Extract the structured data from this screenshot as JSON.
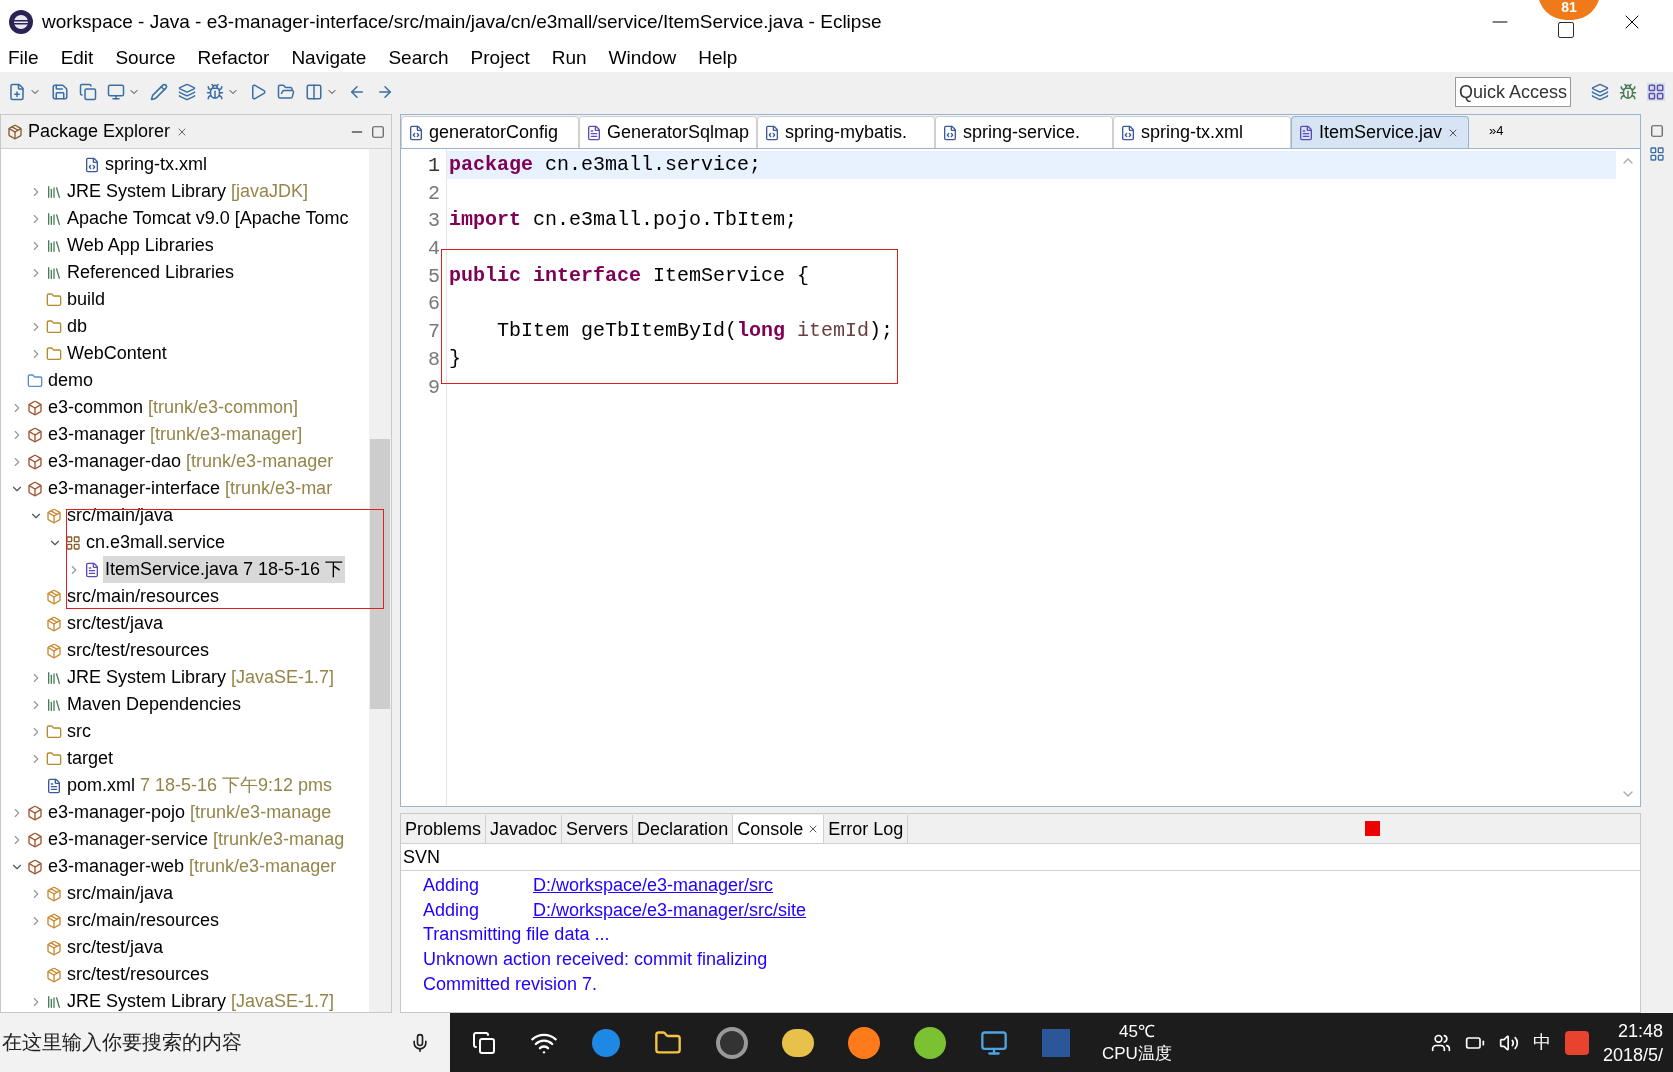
{
  "window": {
    "title": "workspace - Java - e3-manager-interface/src/main/java/cn/e3mall/service/ItemService.java - Eclipse",
    "badge": "81"
  },
  "menu": [
    "File",
    "Edit",
    "Source",
    "Refactor",
    "Navigate",
    "Search",
    "Project",
    "Run",
    "Window",
    "Help"
  ],
  "quick_access": {
    "placeholder": "Quick Access"
  },
  "package_explorer": {
    "title": "Package Explorer",
    "tree": [
      {
        "children": [
          {
            "children": [
              {
                "children": [
                  {
                    "label": "spring-tx.xml",
                    "kind": "xml",
                    "selected": false
                  }
                ]
              }
            ]
          },
          {
            "label": "JRE System Library",
            "decoration": "[javaJDK]",
            "kind": "library",
            "expanded": false,
            "selected": false
          },
          {
            "label": "Apache Tomcat v9.0 [Apache Tomc",
            "kind": "library",
            "expanded": false,
            "selected": false
          },
          {
            "label": "Web App Libraries",
            "kind": "library",
            "expanded": false,
            "selected": false
          },
          {
            "label": "Referenced Libraries",
            "kind": "library",
            "expanded": false,
            "selected": false
          },
          {
            "label": "build",
            "kind": "folder",
            "selected": false
          },
          {
            "label": "db",
            "kind": "folder",
            "expanded": false,
            "selected": false
          },
          {
            "label": "WebContent",
            "kind": "folder",
            "expanded": false,
            "selected": false
          }
        ]
      },
      {
        "label": "demo",
        "kind": "plain-project",
        "selected": false
      },
      {
        "label": "e3-common",
        "decoration": "[trunk/e3-common]",
        "kind": "project",
        "expanded": false,
        "selected": false
      },
      {
        "label": "e3-manager",
        "decoration": "[trunk/e3-manager]",
        "kind": "project",
        "expanded": false,
        "selected": false
      },
      {
        "label": "e3-manager-dao",
        "decoration": "[trunk/e3-manager",
        "kind": "project",
        "expanded": false,
        "selected": false
      },
      {
        "label": "e3-manager-interface",
        "decoration": "[trunk/e3-mar",
        "kind": "project",
        "expanded": true,
        "selected": false,
        "children": [
          {
            "label": "src/main/java",
            "kind": "source-folder",
            "expanded": true,
            "selected": false,
            "children": [
              {
                "label": "cn.e3mall.service",
                "kind": "package",
                "expanded": true,
                "selected": false,
                "children": [
                  {
                    "label": "ItemService.java",
                    "decoration": "7  18-5-16 下",
                    "kind": "java",
                    "expanded": false,
                    "selected": true
                  }
                ]
              }
            ]
          },
          {
            "label": "src/main/resources",
            "kind": "source-folder",
            "selected": false
          },
          {
            "label": "src/test/java",
            "kind": "source-folder",
            "selected": false
          },
          {
            "label": "src/test/resources",
            "kind": "source-folder",
            "selected": false
          },
          {
            "label": "JRE System Library",
            "decoration": "[JavaSE-1.7]",
            "kind": "library",
            "expanded": false,
            "selected": false
          },
          {
            "label": "Maven Dependencies",
            "kind": "library",
            "expanded": false,
            "selected": false
          },
          {
            "label": "src",
            "kind": "folder",
            "expanded": false,
            "selected": false
          },
          {
            "label": "target",
            "kind": "folder",
            "expanded": false,
            "selected": false
          },
          {
            "label": "pom.xml",
            "decoration": "7  18-5-16 下午9:12  pms",
            "kind": "xml-file",
            "selected": false
          }
        ]
      },
      {
        "label": "e3-manager-pojo",
        "decoration": "[trunk/e3-manage",
        "kind": "project",
        "expanded": false,
        "selected": false
      },
      {
        "label": "e3-manager-service",
        "decoration": "[trunk/e3-manag",
        "kind": "project",
        "expanded": false,
        "selected": false
      },
      {
        "label": "e3-manager-web",
        "decoration": "[trunk/e3-manager",
        "kind": "project",
        "expanded": true,
        "selected": false,
        "children": [
          {
            "label": "src/main/java",
            "kind": "source-folder",
            "expanded": false,
            "selected": false
          },
          {
            "label": "src/main/resources",
            "kind": "source-folder",
            "expanded": false,
            "selected": false
          },
          {
            "label": "src/test/java",
            "kind": "source-folder",
            "selected": false
          },
          {
            "label": "src/test/resources",
            "kind": "source-folder",
            "selected": false
          },
          {
            "label": "JRE System Library",
            "decoration": "[JavaSE-1.7]",
            "kind": "library",
            "expanded": false,
            "selected": false
          }
        ]
      }
    ]
  },
  "editor": {
    "tabs": [
      {
        "label": "generatorConfig",
        "kind": "xml",
        "selected": false
      },
      {
        "label": "GeneratorSqlmap",
        "kind": "java",
        "selected": false
      },
      {
        "label": "spring-mybatis.",
        "kind": "xml",
        "selected": false
      },
      {
        "label": "spring-service.",
        "kind": "xml",
        "selected": false
      },
      {
        "label": "spring-tx.xml",
        "kind": "xml",
        "selected": false
      },
      {
        "label": "ItemService.jav",
        "kind": "java",
        "selected": true
      }
    ],
    "overflow": "»4",
    "lines": [
      {
        "number": "1",
        "current": true,
        "tokens": [
          {
            "text": "package",
            "kind": "keyword"
          },
          {
            "text": " cn.e3mall.service;",
            "kind": "plain"
          }
        ]
      },
      {
        "number": "2",
        "current": false
      },
      {
        "number": "3",
        "current": false,
        "tokens": [
          {
            "text": "import",
            "kind": "keyword"
          },
          {
            "text": " cn.e3mall.pojo.TbItem;",
            "kind": "plain"
          }
        ]
      },
      {
        "number": "4",
        "current": false
      },
      {
        "number": "5",
        "current": false,
        "tokens": [
          {
            "text": "public interface",
            "kind": "keyword"
          },
          {
            "text": " ItemService {",
            "kind": "plain"
          }
        ]
      },
      {
        "number": "6",
        "current": false
      },
      {
        "number": "7",
        "current": false,
        "tokens": [
          {
            "text": "    TbItem geTbItemById(",
            "kind": "plain"
          },
          {
            "text": "long",
            "kind": "keyword"
          },
          {
            "text": " itemId",
            "kind": "parameter"
          },
          {
            "text": ");",
            "kind": "plain"
          }
        ]
      },
      {
        "number": "8",
        "current": false,
        "tokens": [
          {
            "text": "}",
            "kind": "plain"
          }
        ]
      },
      {
        "number": "9",
        "current": false
      }
    ]
  },
  "bottom_panel": {
    "tabs": [
      {
        "label": "Problems",
        "selected": false
      },
      {
        "label": "Javadoc",
        "selected": false
      },
      {
        "label": "Servers",
        "selected": false
      },
      {
        "label": "Declaration",
        "selected": false
      },
      {
        "label": "Console",
        "selected": true
      },
      {
        "label": "Error Log",
        "selected": false
      }
    ],
    "console_title": "SVN",
    "lines": [
      {
        "text": "Adding",
        "link": "D:/workspace/e3-manager/src"
      },
      {
        "text": "Adding",
        "link": "D:/workspace/e3-manager/src/site"
      },
      {
        "text": "Transmitting file data ..."
      },
      {
        "text": "Unknown action received: commit finalizing"
      },
      {
        "text": "Committed revision 7."
      }
    ]
  },
  "taskbar": {
    "search": {
      "placeholder": "在这里输入你要搜索的内容"
    },
    "temperature": "45℃",
    "temperature_label": "CPU温度",
    "ime": "中",
    "time": "21:48",
    "date": "2018/5/"
  }
}
